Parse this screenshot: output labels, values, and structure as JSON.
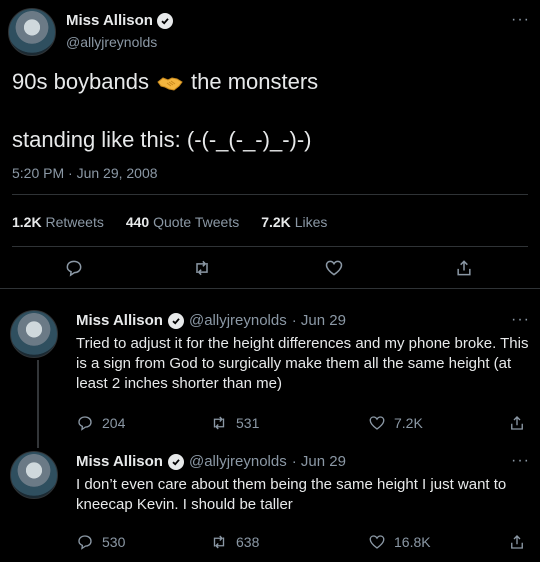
{
  "main_tweet": {
    "name": "Miss Allison",
    "handle": "@allyjreynolds",
    "line1_pre": "90s boybands",
    "line1_emoji": "handshake-emoji",
    "line1_post": "the monsters",
    "line2": "standing like this: (-(-_(-_-)_-)-)",
    "timestamp": "5:20 PM · Jun 29, 2008",
    "stats": {
      "retweets_count": "1.2K",
      "retweets_label": "Retweets",
      "quotes_count": "440",
      "quotes_label": "Quote Tweets",
      "likes_count": "7.2K",
      "likes_label": "Likes"
    },
    "more": "···"
  },
  "replies": [
    {
      "name": "Miss Allison",
      "handle": "@allyjreynolds",
      "date": "· Jun 29",
      "text": "Tried to adjust it for the height differences and my phone broke. This is a sign from God to surgically make them all the same height (at least 2 inches shorter than me)",
      "replies": "204",
      "retweets": "531",
      "likes": "7.2K",
      "more": "···"
    },
    {
      "name": "Miss Allison",
      "handle": "@allyjreynolds",
      "date": "· Jun 29",
      "text": "I don’t even care about them being the same height I just want to kneecap Kevin. I should be taller",
      "replies": "530",
      "retweets": "638",
      "likes": "16.8K",
      "more": "···"
    }
  ],
  "colors": {
    "background": "#000000",
    "text": "#e7e9ea",
    "secondary": "#8b98a5",
    "divider": "#2f3336"
  }
}
